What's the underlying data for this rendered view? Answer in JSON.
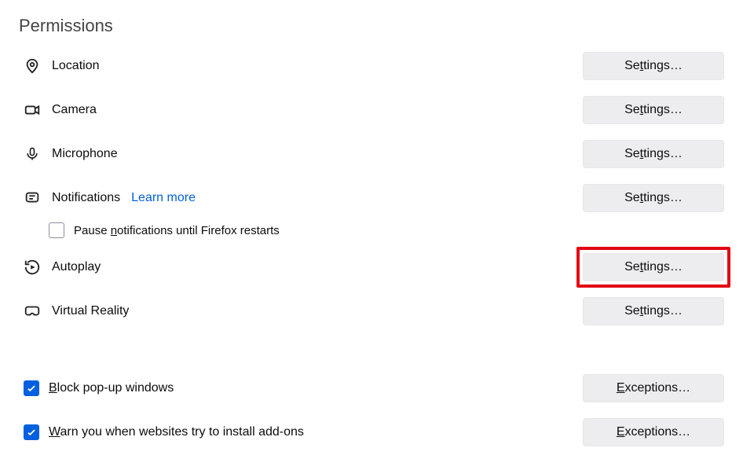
{
  "section_title": "Permissions",
  "buttons": {
    "settings": "Settings…",
    "exceptions": "Exceptions…"
  },
  "rows": {
    "location": {
      "label": "Location"
    },
    "camera": {
      "label": "Camera"
    },
    "microphone": {
      "label": "Microphone"
    },
    "notifications": {
      "label": "Notifications",
      "learn_more": "Learn more"
    },
    "pause_notifications": {
      "label": "Pause notifications until Firefox restarts",
      "checked": false
    },
    "autoplay": {
      "label": "Autoplay",
      "highlighted": true
    },
    "virtual_reality": {
      "label": "Virtual Reality"
    },
    "block_popups": {
      "label": "Block pop-up windows",
      "checked": true
    },
    "warn_addons": {
      "label": "Warn you when websites try to install add-ons",
      "checked": true
    }
  }
}
